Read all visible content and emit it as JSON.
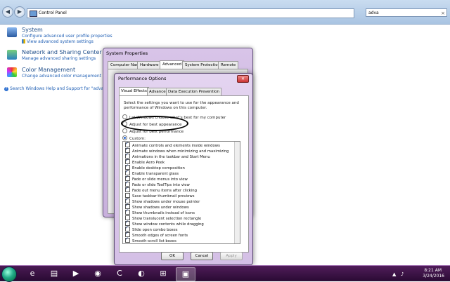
{
  "addressbar": {
    "path": "Control Panel",
    "search_value": "adva",
    "clear_glyph": "×",
    "back_glyph": "◀",
    "forward_glyph": "▶"
  },
  "results": [
    {
      "title": "System",
      "icon": "computer-icon",
      "links": [
        "Configure advanced user profile properties",
        "View advanced system settings"
      ]
    },
    {
      "title": "Network and Sharing Center",
      "icon": "network-icon",
      "links": [
        "Manage advanced sharing settings"
      ]
    },
    {
      "title": "Color Management",
      "icon": "color-icon",
      "links": [
        "Change advanced color management setti"
      ]
    }
  ],
  "help_link": "Search Windows Help and Support for \"adva\"",
  "help_glyph": "?",
  "system_properties": {
    "title": "System Properties",
    "tabs": [
      "Computer Name",
      "Hardware",
      "Advanced",
      "System Protection",
      "Remote"
    ],
    "active_tab": "Advanced"
  },
  "performance_options": {
    "title": "Performance Options",
    "close_glyph": "✕",
    "tabs": [
      "Visual Effects",
      "Advanced",
      "Data Execution Prevention"
    ],
    "active_tab": "Visual Effects",
    "intro": "Select the settings you want to use for the appearance and performance of Windows on this computer.",
    "radios": [
      {
        "label": "Let Windows choose what's best for my computer",
        "selected": false
      },
      {
        "label": "Adjust for best appearance",
        "selected": false
      },
      {
        "label": "Adjust for best performance",
        "selected": false
      },
      {
        "label": "Custom:",
        "selected": true
      }
    ],
    "effects": [
      "Animate controls and elements inside windows",
      "Animate windows when minimizing and maximizing",
      "Animations in the taskbar and Start Menu",
      "Enable Aero Peek",
      "Enable desktop composition",
      "Enable transparent glass",
      "Fade or slide menus into view",
      "Fade or slide ToolTips into view",
      "Fade out menu items after clicking",
      "Save taskbar thumbnail previews",
      "Show shadows under mouse pointer",
      "Show shadows under windows",
      "Show thumbnails instead of icons",
      "Show translucent selection rectangle",
      "Show window contents while dragging",
      "Slide open combo boxes",
      "Smooth edges of screen fonts",
      "Smooth-scroll list boxes"
    ],
    "buttons": {
      "ok": "OK",
      "cancel": "Cancel",
      "apply": "Apply"
    }
  },
  "taskbar": {
    "items": [
      {
        "name": "internet-explorer-icon",
        "glyph": "e"
      },
      {
        "name": "file-explorer-icon",
        "glyph": "▤"
      },
      {
        "name": "media-player-icon",
        "glyph": "▶"
      },
      {
        "name": "chrome-icon",
        "glyph": "◉"
      },
      {
        "name": "browser-icon",
        "glyph": "C"
      },
      {
        "name": "app-icon",
        "glyph": "◐"
      },
      {
        "name": "network-icon",
        "glyph": "⊞"
      },
      {
        "name": "control-panel-icon",
        "glyph": "▣"
      }
    ],
    "active_index": 7,
    "clock_time": "8:21 AM",
    "clock_date": "3/24/2016",
    "tray_glyphs": {
      "expand": "▲",
      "volume": "♪"
    }
  },
  "colors": {
    "desktop_accent": "#a040a0",
    "link": "#1e5eb4",
    "title_blue": "#1f4e8a"
  }
}
